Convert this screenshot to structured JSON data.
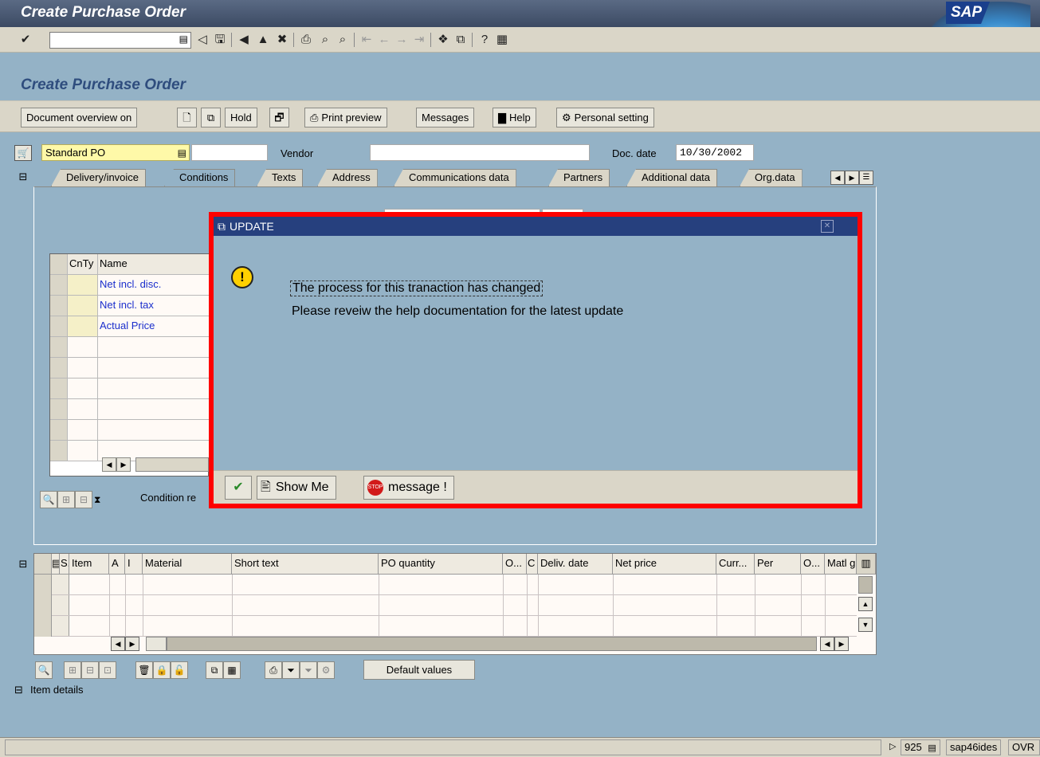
{
  "window": {
    "title": "Create Purchase Order",
    "logo_text": "SAP"
  },
  "toolbar": {
    "command_value": ""
  },
  "page": {
    "title": "Create Purchase Order"
  },
  "app_toolbar": {
    "document_overview": "Document overview on",
    "hold": "Hold",
    "print_preview": "Print preview",
    "messages": "Messages",
    "help": "Help",
    "personal_setting": "Personal setting"
  },
  "header": {
    "po_type": "Standard PO",
    "vendor_label": "Vendor",
    "vendor_value": "",
    "doc_date_label": "Doc. date",
    "doc_date_value": "10/30/2002"
  },
  "tabs": [
    {
      "label": "Delivery/invoice"
    },
    {
      "label": "Conditions"
    },
    {
      "label": "Texts"
    },
    {
      "label": "Address"
    },
    {
      "label": "Communications data"
    },
    {
      "label": "Partners"
    },
    {
      "label": "Additional data"
    },
    {
      "label": "Org.data"
    }
  ],
  "conditions": {
    "headers": [
      "CnTy",
      "Name"
    ],
    "rows": [
      "Net incl. disc.",
      "Net incl. tax",
      "Actual Price"
    ],
    "condition_button": "Condition re"
  },
  "dialog": {
    "title": "UPDATE",
    "line1": "The process for this tranaction has changed",
    "line2": "Please reveiw the help documentation for the latest update",
    "show_me": "Show Me",
    "message": "message !"
  },
  "items": {
    "headers": [
      "S..",
      "Item",
      "A",
      "I",
      "Material",
      "Short text",
      "PO quantity",
      "O...",
      "C",
      "Deliv. date",
      "Net price",
      "Curr...",
      "Per",
      "O...",
      "Matl g"
    ],
    "default_values": "Default values",
    "item_details": "Item details"
  },
  "status": {
    "client": "925",
    "server": "sap46ides",
    "mode": "OVR"
  },
  "colors": {
    "title_bar": "#3c4a63",
    "dialog_title": "#26407e",
    "highlight": "#ff0000",
    "background": "#94b2c6"
  }
}
